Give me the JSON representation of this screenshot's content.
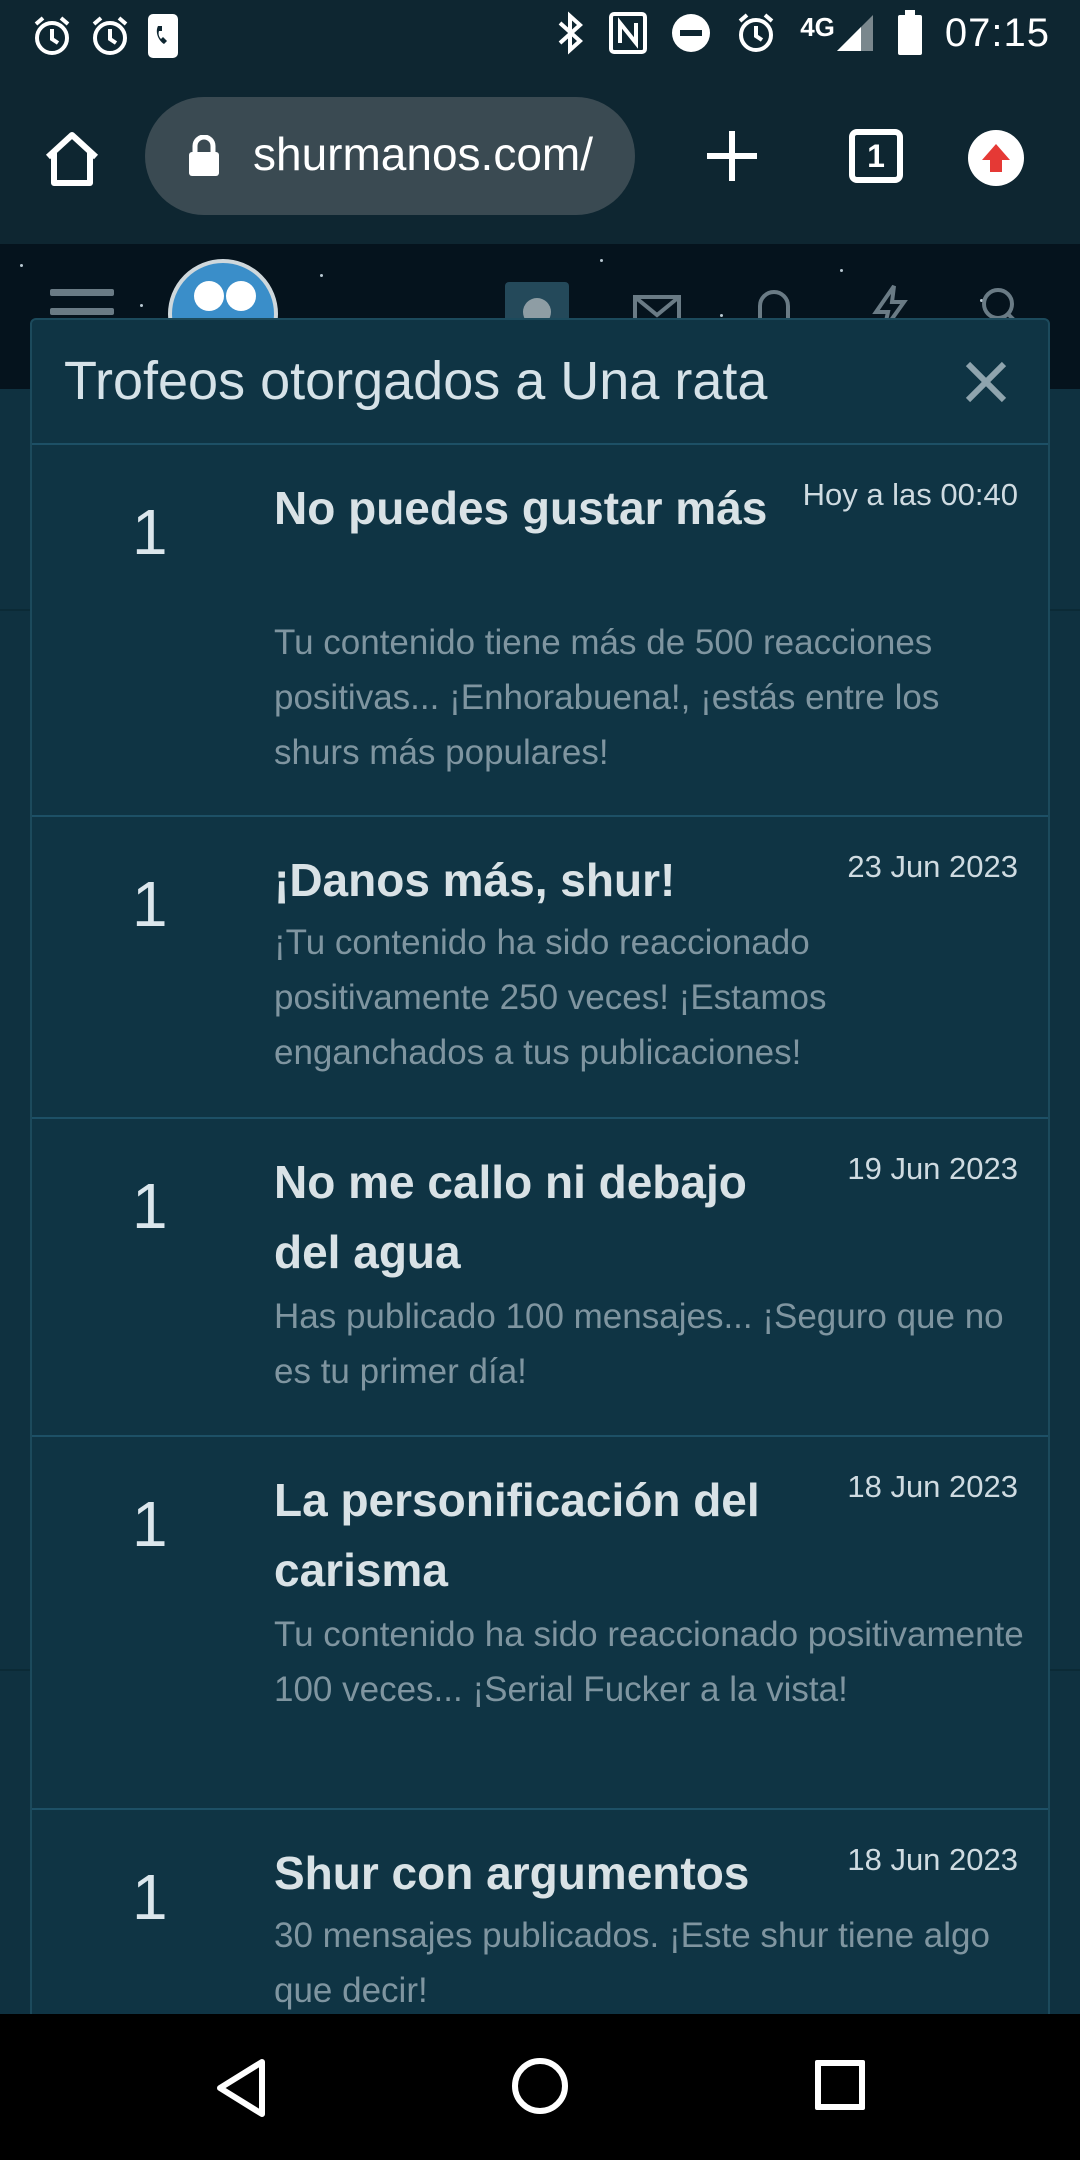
{
  "status_bar": {
    "time": "07:15",
    "network": "4G",
    "icons": [
      "alarm-icon",
      "alarm-icon",
      "phone-icon",
      "bluetooth-icon",
      "nfc-icon",
      "do-not-disturb-icon",
      "alarm-icon",
      "signal-icon",
      "battery-icon"
    ]
  },
  "browser": {
    "url": "shurmanos.com/",
    "tab_count": "1",
    "icons": [
      "home-icon",
      "lock-icon",
      "plus-icon",
      "tabs-icon",
      "update-icon"
    ]
  },
  "modal": {
    "title": "Trofeos otorgados a Una rata",
    "close_icon": "close-icon",
    "trophies": [
      {
        "points": "1",
        "title": "No puedes gustar más",
        "date": "Hoy a las 00:40",
        "description": "Tu contenido tiene más de 500 reacciones positivas... ¡Enhorabuena!, ¡estás entre los shurs más populares!"
      },
      {
        "points": "1",
        "title": "¡Danos más, shur!",
        "date": "23 Jun 2023",
        "description": "¡Tu contenido ha sido reaccionado positivamente 250 veces! ¡Estamos enganchados a tus publicaciones!"
      },
      {
        "points": "1",
        "title": "No me callo ni debajo del agua",
        "date": "19 Jun 2023",
        "description": "Has publicado 100 mensajes... ¡Seguro que no es tu primer día!"
      },
      {
        "points": "1",
        "title": "La personificación del carisma",
        "date": "18 Jun 2023",
        "description": "Tu contenido ha sido reaccionado positivamente 100 veces... ¡Serial Fucker a la vista!"
      },
      {
        "points": "1",
        "title": "Shur con argumentos",
        "date": "18 Jun 2023",
        "description": "30 mensajes publicados. ¡Este shur tiene algo que decir!"
      }
    ]
  },
  "nav_bar": {
    "icons": [
      "back-icon",
      "home-circle-icon",
      "recents-icon"
    ]
  }
}
